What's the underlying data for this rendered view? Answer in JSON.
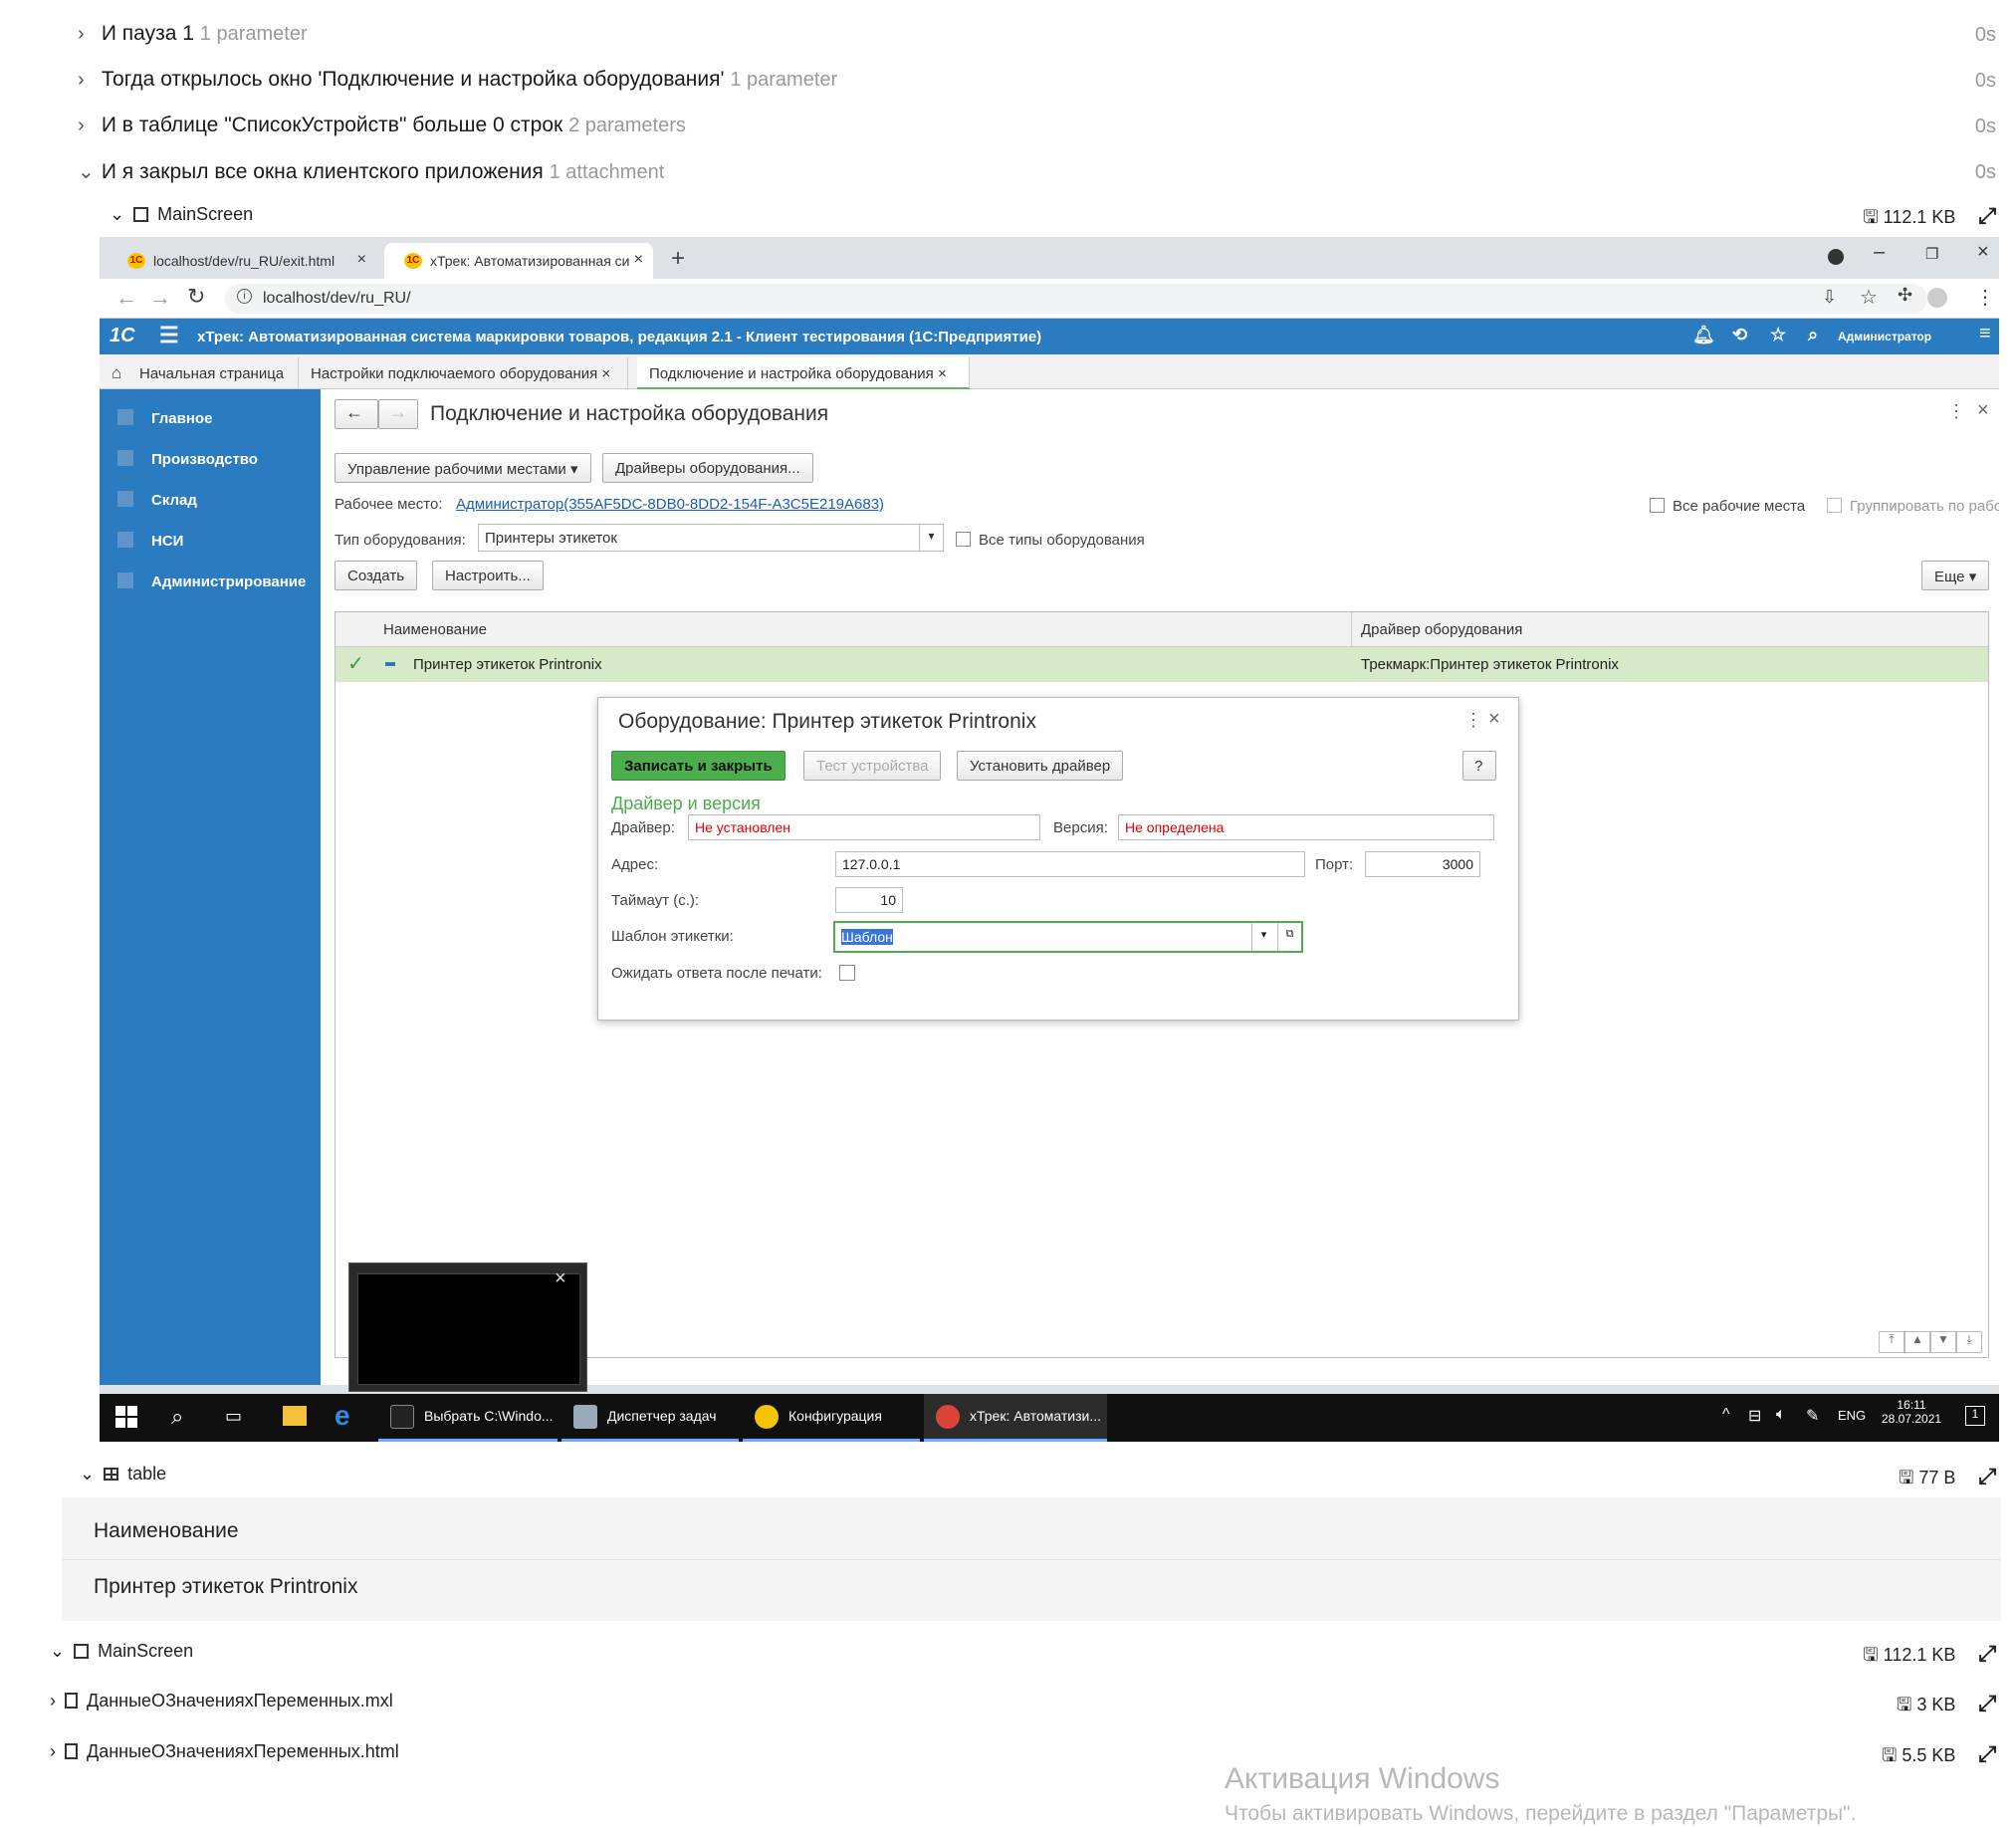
{
  "steps": [
    {
      "text": "И пауза 1",
      "meta": "1 parameter",
      "duration": "0s",
      "expanded": false
    },
    {
      "text": "Тогда открылось окно 'Подключение и настройка оборудования'",
      "meta": "1 parameter",
      "duration": "0s",
      "expanded": false
    },
    {
      "text": "И в таблице \"СписокУстройств\" больше 0 строк",
      "meta": "2 parameters",
      "duration": "0s",
      "expanded": false
    },
    {
      "text": "И я закрыл все окна клиентского приложения",
      "meta": "1 attachment",
      "duration": "0s",
      "expanded": true
    }
  ],
  "attachments": {
    "main_screen_1": {
      "name": "MainScreen",
      "size": "112.1 KB"
    },
    "table": {
      "name": "table",
      "size": "77 B"
    },
    "main_screen_2": {
      "name": "MainScreen",
      "size": "112.1 KB"
    },
    "mxl": {
      "name": "ДанныеОЗначенияхПеременных.mxl",
      "size": "3 KB"
    },
    "html": {
      "name": "ДанныеОЗначенияхПеременных.html",
      "size": "5.5 KB"
    }
  },
  "table_block": {
    "header": "Наименование",
    "row": "Принтер этикеток Printronix"
  },
  "browser": {
    "tabs": [
      {
        "title": "localhost/dev/ru_RU/exit.html"
      },
      {
        "title": "хТрек: Автоматизированная си"
      }
    ],
    "new_tab": "+",
    "url": "localhost/dev/ru_RU/"
  },
  "onec": {
    "logo": "1С",
    "title": "хТрек: Автоматизированная система маркировки товаров, редакция 2.1  - Клиент тестирования (1С:Предприятие)",
    "user": "Администратор",
    "tabs": [
      {
        "label": "Начальная страница"
      },
      {
        "label": "Настройки подключаемого оборудования"
      },
      {
        "label": "Подключение и настройка оборудования"
      }
    ],
    "sidebar": [
      "Главное",
      "Производство",
      "Склад",
      "НСИ",
      "Администрирование"
    ],
    "form_title": "Подключение и настройка оборудования",
    "btn_workplaces": "Управление рабочими местами",
    "btn_drivers": "Драйверы оборудования...",
    "workplace_label": "Рабочее место:",
    "workplace_link": "Администратор(355AF5DC-8DB0-8DD2-154F-A3C5E219A683)",
    "all_workplaces": "Все рабочие места",
    "group_by_workplace": "Группировать по рабочему месту",
    "equip_type_label": "Тип оборудования:",
    "equip_type_value": "Принтеры этикеток",
    "all_types": "Все типы оборудования",
    "btn_create": "Создать",
    "btn_configure": "Настроить...",
    "btn_more": "Еще",
    "grid": {
      "col_name": "Наименование",
      "col_driver": "Драйвер оборудования",
      "row_name": "Принтер этикеток Printronix",
      "row_driver": "Трекмарк:Принтер этикеток Printronix"
    }
  },
  "modal": {
    "title": "Оборудование: Принтер этикеток Printronix",
    "btn_save_close": "Записать и закрыть",
    "btn_test": "Тест устройства",
    "btn_install": "Установить драйвер",
    "btn_help": "?",
    "section": "Драйвер и версия",
    "driver_label": "Драйвер:",
    "driver_value": "Не установлен",
    "version_label": "Версия:",
    "version_value": "Не определена",
    "address_label": "Адрес:",
    "address_value": "127.0.0.1",
    "port_label": "Порт:",
    "port_value": "3000",
    "timeout_label": "Таймаут (с.):",
    "timeout_value": "10",
    "template_label": "Шаблон этикетки:",
    "template_value": "Шаблон",
    "wait_label": "Ожидать ответа после печати:"
  },
  "taskbar": {
    "items": [
      "Выбрать C:\\Windo...",
      "Диспетчер задач",
      "Конфигурация",
      "хТрек: Автоматизи..."
    ],
    "lang": "ENG",
    "time": "16:11",
    "date": "28.07.2021"
  },
  "watermark": {
    "title": "Активация Windows",
    "subtitle": "Чтобы активировать Windows, перейдите в раздел \"Параметры\"."
  }
}
